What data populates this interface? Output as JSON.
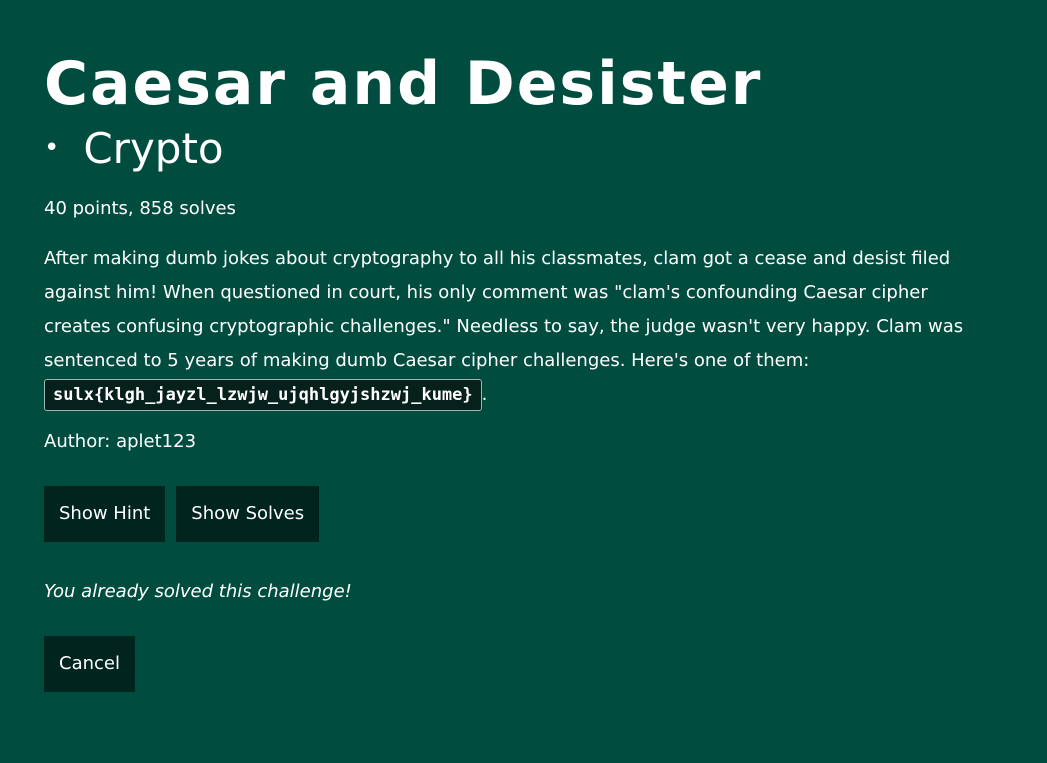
{
  "challenge": {
    "title": "Caesar and Desister",
    "bullet": "•",
    "category": "Crypto",
    "meta": "40 points, 858 solves",
    "description": "After making dumb jokes about cryptography to all his classmates, clam got a cease and desist filed against him! When questioned in court, his only comment was \"clam's confounding Caesar cipher creates confusing cryptographic challenges.\" Needless to say, the judge wasn't very happy. Clam was sentenced to 5 years of making dumb Caesar cipher challenges. Here's one of them:",
    "flag": "sulx{klgh_jayzl_lzwjw_ujqhlgyjshzwj_kume}",
    "flag_suffix": ".",
    "author": "Author: aplet123"
  },
  "actions": {
    "show_hint_label": "Show Hint",
    "show_solves_label": "Show Solves",
    "solved_message": "You already solved this challenge!",
    "cancel_label": "Cancel"
  },
  "colors": {
    "background": "#004d40",
    "button_background": "#00251e",
    "text": "#ffffff"
  }
}
